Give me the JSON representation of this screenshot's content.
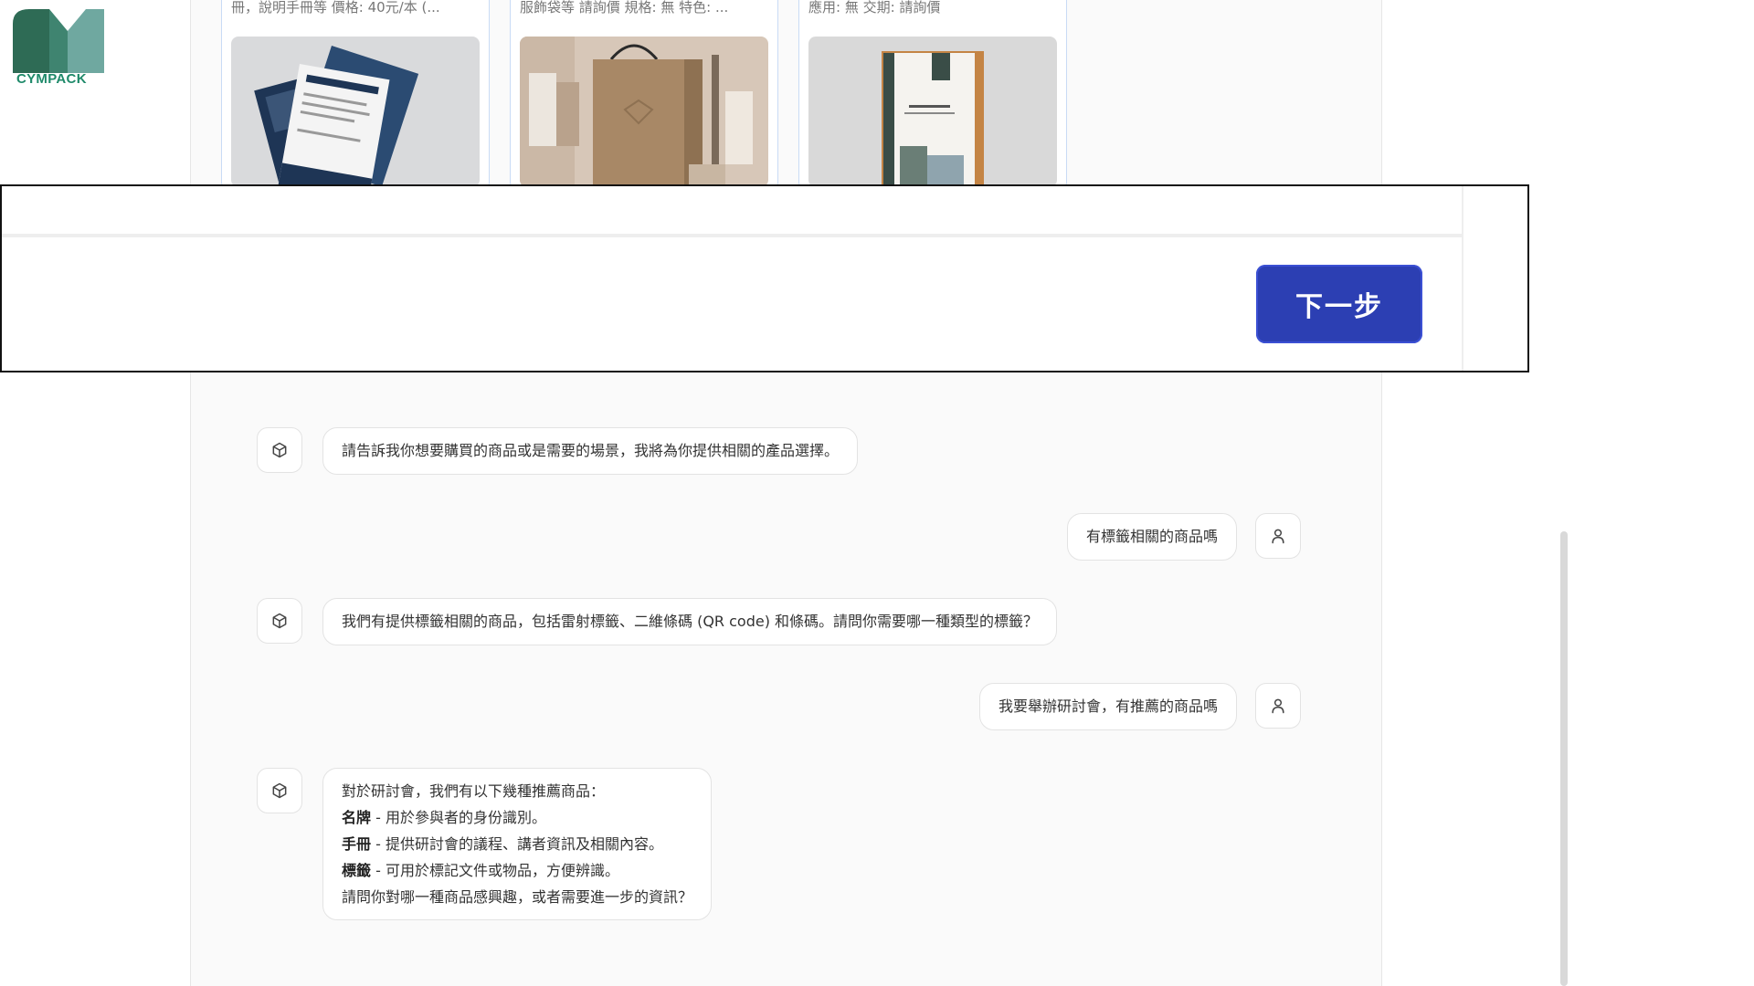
{
  "brand": {
    "logo_text": "CYMPACK",
    "colors": {
      "dark": "#2e6b55",
      "mid": "#3f8470",
      "light": "#6fa8a0"
    }
  },
  "products": [
    {
      "desc": "冊，說明手冊等 價格: 40元/本 (...",
      "image": "brochure-image"
    },
    {
      "desc": "服飾袋等 請詢價 規格: 無 特色: ...",
      "image": "paper-bag-image"
    },
    {
      "desc": "應用: 無 交期: 請詢價",
      "image": "booklet-image"
    }
  ],
  "action": {
    "next_label": "下一步",
    "accent": "#2c3fb3"
  },
  "chat": [
    {
      "role": "assistant",
      "text": "請告訴我你想要購買的商品或是需要的場景，我將為你提供相關的產品選擇。"
    },
    {
      "role": "user",
      "text": "有標籤相關的商品嗎"
    },
    {
      "role": "assistant",
      "text": "我們有提供標籤相關的商品，包括雷射標籤、二維條碼 (QR code) 和條碼。請問你需要哪一種類型的標籤？"
    },
    {
      "role": "user",
      "text": "我要舉辦研討會，有推薦的商品嗎"
    },
    {
      "role": "assistant",
      "intro": "對於研討會，我們有以下幾種推薦商品：",
      "items": [
        {
          "name": "名牌",
          "desc": " - 用於參與者的身份識別。"
        },
        {
          "name": "手冊",
          "desc": " - 提供研討會的議程、講者資訊及相關內容。"
        },
        {
          "name": "標籤",
          "desc": " - 可用於標記文件或物品，方便辨識。"
        }
      ],
      "outro": "請問你對哪一種商品感興趣，或者需要進一步的資訊？"
    }
  ]
}
